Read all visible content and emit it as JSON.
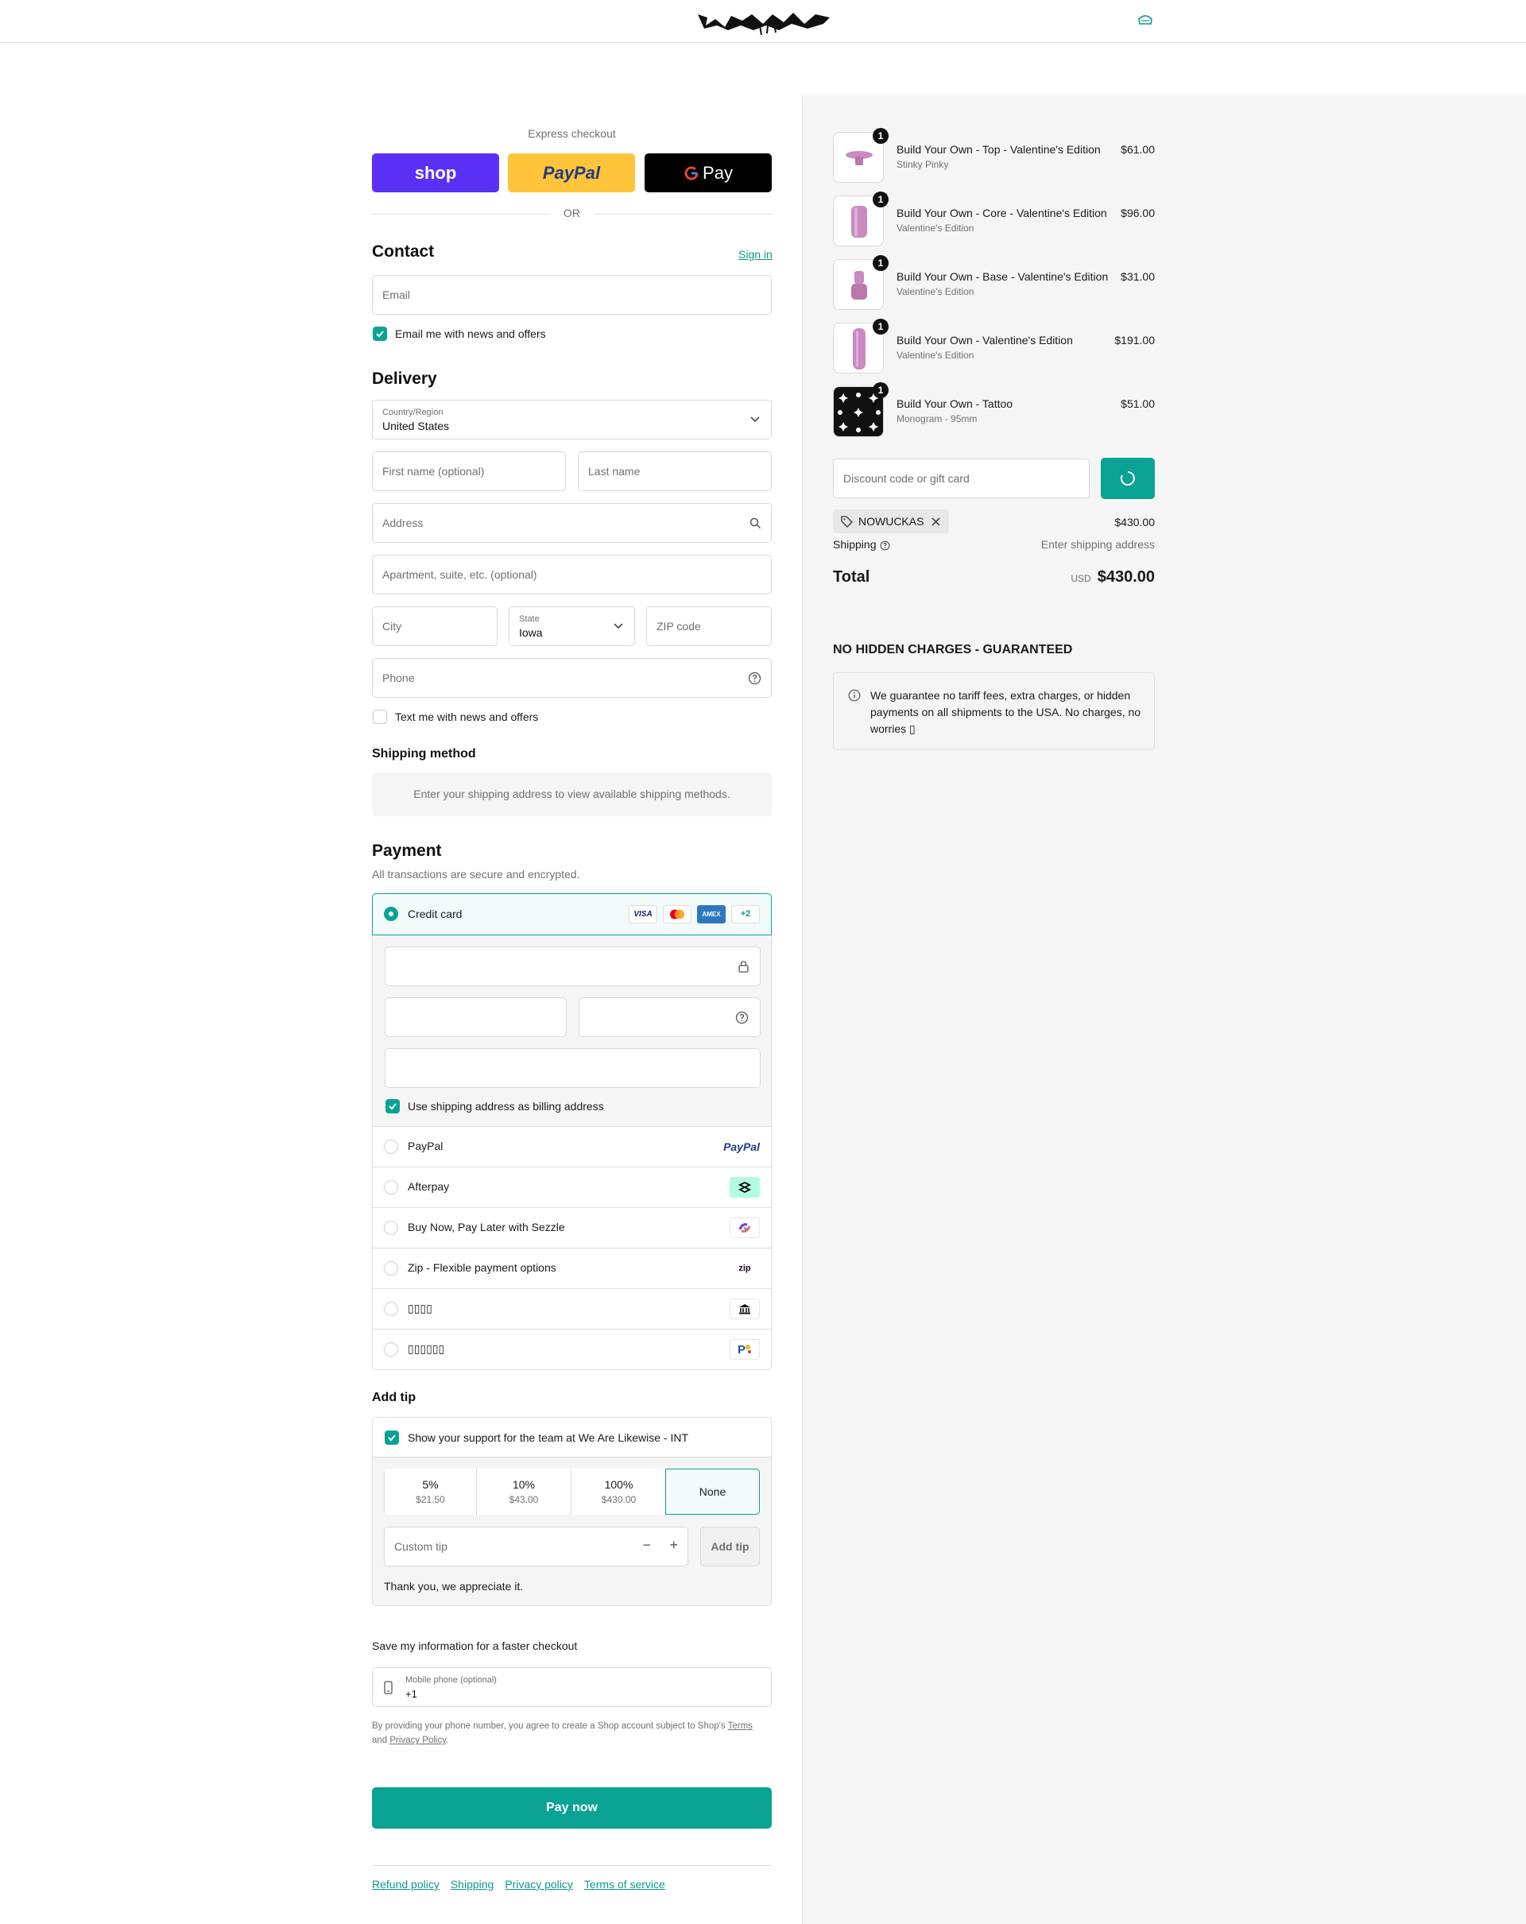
{
  "brand": {
    "logo_text": "LIKEWISE",
    "accent": "#0aa393",
    "shop_purple": "#5a31f4",
    "paypal_yellow": "#ffc439"
  },
  "express": {
    "title": "Express checkout",
    "shop_label": "shop",
    "paypal_label": "PayPal",
    "gpay_label": "Pay",
    "or_label": "OR"
  },
  "contact": {
    "heading": "Contact",
    "sign_in": "Sign in",
    "email_placeholder": "Email",
    "email_news": "Email me with news and offers"
  },
  "delivery": {
    "heading": "Delivery",
    "country_label": "Country/Region",
    "country_value": "United States",
    "first_name_ph": "First name (optional)",
    "last_name_ph": "Last name",
    "address_ph": "Address",
    "apartment_ph": "Apartment, suite, etc. (optional)",
    "city_ph": "City",
    "state_label": "State",
    "state_value": "Iowa",
    "zip_ph": "ZIP code",
    "phone_ph": "Phone",
    "text_news": "Text me with news and offers"
  },
  "shipping_method": {
    "heading": "Shipping method",
    "message": "Enter your shipping address to view available shipping methods."
  },
  "payment": {
    "heading": "Payment",
    "subtitle": "All transactions are secure and encrypted.",
    "credit_card": "Credit card",
    "more_cards": "+2",
    "card_logos": {
      "visa": "VISA",
      "amex": "AMEX"
    },
    "billing_same": "Use shipping address as billing address",
    "methods": [
      {
        "label": "PayPal",
        "icon": "paypal-logo",
        "icon_text": "PayPal"
      },
      {
        "label": "Afterpay",
        "icon": "afterpay-logo",
        "icon_text": ""
      },
      {
        "label": "Buy Now, Pay Later with Sezzle",
        "icon": "sezzle-logo",
        "icon_text": ""
      },
      {
        "label": "Zip - Flexible payment options",
        "icon": "zip-logo",
        "icon_text": "zip"
      },
      {
        "label": "▯▯▯▯",
        "icon": "bank-icon",
        "icon_text": ""
      },
      {
        "label": "▯▯▯▯▯▯",
        "icon": "pay-easy-logo",
        "icon_text": ""
      }
    ]
  },
  "tip": {
    "heading": "Add tip",
    "support_label": "Show your support for the team at We Are Likewise - INT",
    "options": [
      {
        "percent": "5%",
        "amount": "$21.50"
      },
      {
        "percent": "10%",
        "amount": "$43.00"
      },
      {
        "percent": "100%",
        "amount": "$430.00"
      }
    ],
    "none_label": "None",
    "custom_ph": "Custom tip",
    "minus": "−",
    "plus": "+",
    "add_label": "Add tip",
    "thanks": "Thank you, we appreciate it."
  },
  "save_info": {
    "heading": "Save my information for a faster checkout",
    "phone_label": "Mobile phone (optional)",
    "phone_value": "+1",
    "legal_1": "By providing your phone number, you agree to create a Shop account subject to Shop's ",
    "terms": "Terms",
    "legal_2": "and ",
    "privacy": "Privacy Policy",
    "legal_3": "."
  },
  "pay_now": "Pay now",
  "footer_links": [
    "Refund policy",
    "Shipping",
    "Privacy policy",
    "Terms of service"
  ],
  "summary": {
    "items": [
      {
        "title": "Build Your Own - Top - Valentine's Edition",
        "variant": "Stinky Pinky",
        "price": "$61.00",
        "qty": "1"
      },
      {
        "title": "Build Your Own - Core - Valentine's Edition",
        "variant": "Valentine's Edition",
        "price": "$96.00",
        "qty": "1"
      },
      {
        "title": "Build Your Own - Base - Valentine's Edition",
        "variant": "Valentine's Edition",
        "price": "$31.00",
        "qty": "1"
      },
      {
        "title": "Build Your Own - Valentine's Edition",
        "variant": "Valentine's Edition",
        "price": "$191.00",
        "qty": "1"
      },
      {
        "title": "Build Your Own - Tattoo",
        "variant": "Monogram - 95mm",
        "price": "$51.00",
        "qty": "1"
      }
    ],
    "discount_ph": "Discount code or gift card",
    "code": "NOWUCKAS",
    "subtotal": "$430.00",
    "shipping_label": "Shipping",
    "shipping_value": "Enter shipping address",
    "total_label": "Total",
    "currency": "USD",
    "total": "$430.00"
  },
  "guarantee": {
    "heading": "NO HIDDEN CHARGES - GUARANTEED",
    "text": "We guarantee no tariff fees, extra charges, or hidden payments on all shipments to the USA. No charges, no worries ▯"
  }
}
